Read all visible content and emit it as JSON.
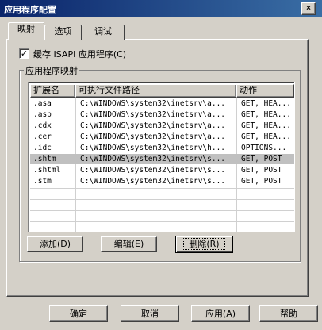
{
  "window": {
    "title": "应用程序配置",
    "close_glyph": "×"
  },
  "tabs": [
    {
      "label": "映射",
      "active": true
    },
    {
      "label": "选项",
      "active": false
    },
    {
      "label": "调试",
      "active": false
    }
  ],
  "cache_checkbox": {
    "checked": true,
    "check_glyph": "✓",
    "label": "缓存 ISAPI 应用程序(C)"
  },
  "mappings_group": {
    "title": "应用程序映射",
    "columns": [
      "扩展名",
      "可执行文件路径",
      "动作"
    ],
    "rows": [
      {
        "ext": ".asa",
        "path": "C:\\WINDOWS\\system32\\inetsrv\\a...",
        "actions": "GET, HEA...",
        "selected": false
      },
      {
        "ext": ".asp",
        "path": "C:\\WINDOWS\\system32\\inetsrv\\a...",
        "actions": "GET, HEA...",
        "selected": false
      },
      {
        "ext": ".cdx",
        "path": "C:\\WINDOWS\\system32\\inetsrv\\a...",
        "actions": "GET, HEA...",
        "selected": false
      },
      {
        "ext": ".cer",
        "path": "C:\\WINDOWS\\system32\\inetsrv\\a...",
        "actions": "GET, HEA...",
        "selected": false
      },
      {
        "ext": ".idc",
        "path": "C:\\WINDOWS\\system32\\inetsrv\\h...",
        "actions": "OPTIONS...",
        "selected": false
      },
      {
        "ext": ".shtm",
        "path": "C:\\WINDOWS\\system32\\inetsrv\\s...",
        "actions": "GET, POST",
        "selected": true
      },
      {
        "ext": ".shtml",
        "path": "C:\\WINDOWS\\system32\\inetsrv\\s...",
        "actions": "GET, POST",
        "selected": false
      },
      {
        "ext": ".stm",
        "path": "C:\\WINDOWS\\system32\\inetsrv\\s...",
        "actions": "GET, POST",
        "selected": false
      }
    ],
    "buttons": {
      "add": "添加(D)",
      "edit": "编辑(E)",
      "delete": "删除(R)"
    }
  },
  "dialog_buttons": {
    "ok": "确定",
    "cancel": "取消",
    "apply": "应用(A)",
    "help": "帮助"
  },
  "colors": {
    "title_bar_start": "#0a246a",
    "title_bar_end": "#3a6ea5",
    "face": "#d4d0c8",
    "selected_row": "#c0c0c0"
  }
}
